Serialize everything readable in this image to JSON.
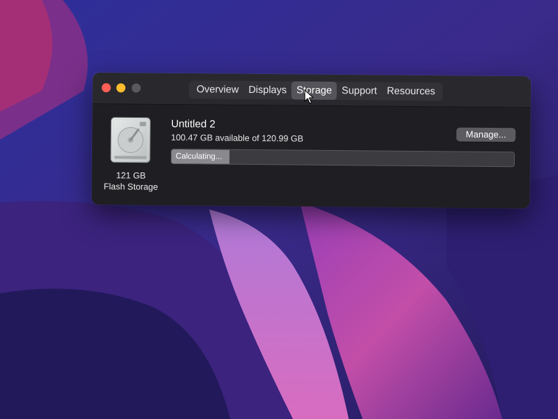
{
  "window": {
    "tabs": [
      {
        "label": "Overview"
      },
      {
        "label": "Displays"
      },
      {
        "label": "Storage"
      },
      {
        "label": "Support"
      },
      {
        "label": "Resources"
      }
    ],
    "active_tab": "Storage"
  },
  "storage": {
    "capacity_label": "121 GB",
    "type_label": "Flash Storage",
    "volume_name": "Untitled 2",
    "available_text": "100.47 GB available of 120.99 GB",
    "progress_label": "Calculating...",
    "progress_fraction": 0.17,
    "manage_label": "Manage..."
  },
  "colors": {
    "close": "#ff5f57",
    "minimize": "#febc2e",
    "zoom_disabled": "#5a595e",
    "window_bg": "#1f1e22"
  },
  "icons": [
    "hard-drive-icon",
    "pointer-cursor-icon"
  ]
}
